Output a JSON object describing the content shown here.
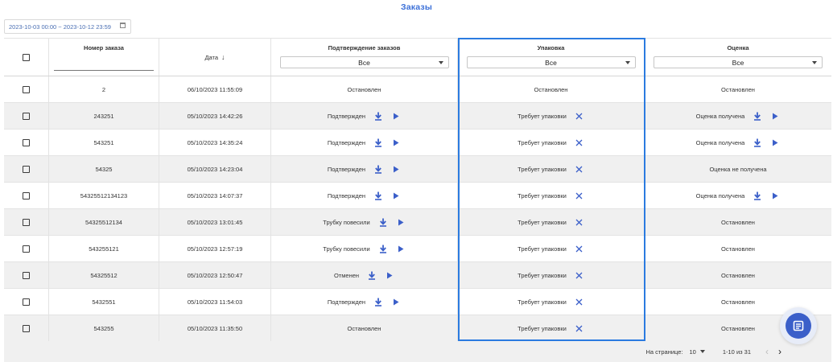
{
  "page": {
    "title": "Заказы"
  },
  "filters": {
    "date_range": "2023-10-03 00:00 ~ 2023-10-12 23:59"
  },
  "table": {
    "columns": {
      "order_number": "Номер заказа",
      "date": "Дата",
      "date_sort_icon": "arrow-down",
      "confirmation": "Подтверждение заказов",
      "packing": "Упаковка",
      "rating": "Оценка"
    },
    "filter_values": {
      "confirmation": "Все",
      "packing": "Все",
      "rating": "Все"
    },
    "rows": [
      {
        "order": "2",
        "date": "06/10/2023 11:55:09",
        "confirmation": "Остановлен",
        "confirmation_actions": false,
        "packing": "Остановлен",
        "packing_cancel": false,
        "rating": "Остановлен",
        "rating_actions": false
      },
      {
        "order": "243251",
        "date": "05/10/2023 14:42:26",
        "confirmation": "Подтвержден",
        "confirmation_actions": true,
        "packing": "Требует упаковки",
        "packing_cancel": true,
        "rating": "Оценка получена",
        "rating_actions": true
      },
      {
        "order": "543251",
        "date": "05/10/2023 14:35:24",
        "confirmation": "Подтвержден",
        "confirmation_actions": true,
        "packing": "Требует упаковки",
        "packing_cancel": true,
        "rating": "Оценка получена",
        "rating_actions": true
      },
      {
        "order": "54325",
        "date": "05/10/2023 14:23:04",
        "confirmation": "Подтвержден",
        "confirmation_actions": true,
        "packing": "Требует упаковки",
        "packing_cancel": true,
        "rating": "Оценка не получена",
        "rating_actions": false
      },
      {
        "order": "54325512134123",
        "date": "05/10/2023 14:07:37",
        "confirmation": "Подтвержден",
        "confirmation_actions": true,
        "packing": "Требует упаковки",
        "packing_cancel": true,
        "rating": "Оценка получена",
        "rating_actions": true
      },
      {
        "order": "54325512134",
        "date": "05/10/2023 13:01:45",
        "confirmation": "Трубку повесили",
        "confirmation_actions": true,
        "packing": "Требует упаковки",
        "packing_cancel": true,
        "rating": "Остановлен",
        "rating_actions": false
      },
      {
        "order": "543255121",
        "date": "05/10/2023 12:57:19",
        "confirmation": "Трубку повесили",
        "confirmation_actions": true,
        "packing": "Требует упаковки",
        "packing_cancel": true,
        "rating": "Остановлен",
        "rating_actions": false
      },
      {
        "order": "54325512",
        "date": "05/10/2023 12:50:47",
        "confirmation": "Отменен",
        "confirmation_actions": true,
        "packing": "Требует упаковки",
        "packing_cancel": true,
        "rating": "Остановлен",
        "rating_actions": false
      },
      {
        "order": "5432551",
        "date": "05/10/2023 11:54:03",
        "confirmation": "Подтвержден",
        "confirmation_actions": true,
        "packing": "Требует упаковки",
        "packing_cancel": true,
        "rating": "Остановлен",
        "rating_actions": false
      },
      {
        "order": "543255",
        "date": "05/10/2023 11:35:50",
        "confirmation": "Остановлен",
        "confirmation_actions": false,
        "packing": "Требует упаковки",
        "packing_cancel": true,
        "rating": "Остановлен",
        "rating_actions": false
      }
    ]
  },
  "pagination": {
    "per_page_label": "На странице:",
    "per_page_value": "10",
    "range_text": "1-10 из 31",
    "prev_icon": "chevron-left-icon",
    "next_icon": "chevron-right-icon"
  },
  "icons": {
    "download": "download-icon",
    "play": "play-icon",
    "cancel": "close-icon",
    "calendar": "calendar-icon",
    "fab": "document-icon"
  },
  "colors": {
    "accent": "#2b7be0",
    "title": "#3a6fd8",
    "icon_blue": "#3b5fc9",
    "row_alt": "#f0f0f0",
    "fab_bg": "#3b5fc9"
  }
}
